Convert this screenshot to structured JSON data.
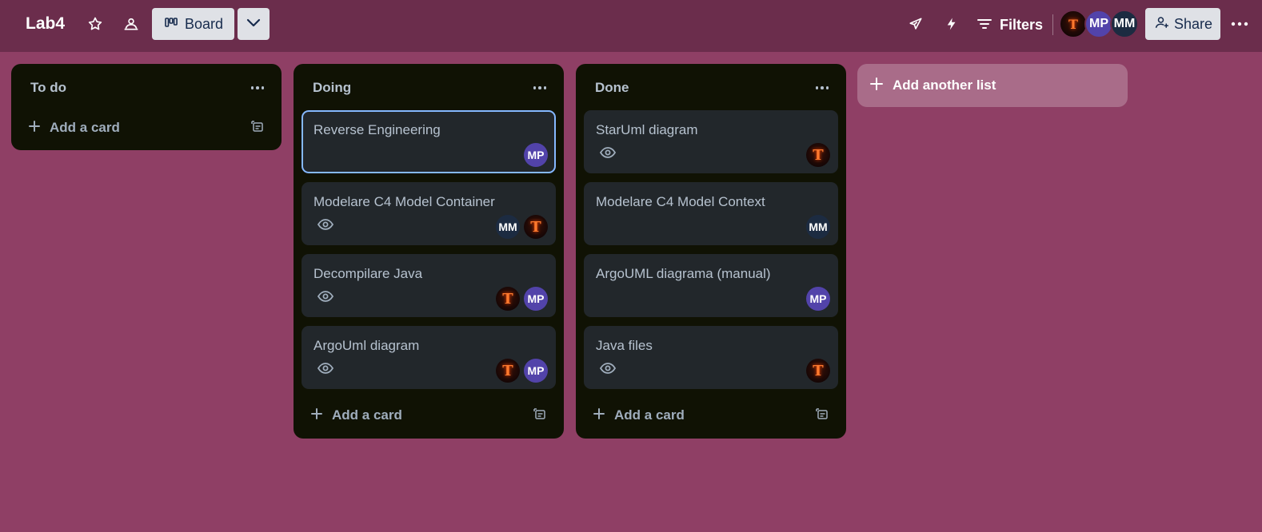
{
  "board": {
    "title": "Lab4",
    "view_label": "Board",
    "filters_label": "Filters",
    "share_label": "Share",
    "members": [
      {
        "initials": "T",
        "kind": "image"
      },
      {
        "initials": "MP"
      },
      {
        "initials": "MM"
      }
    ]
  },
  "colors": {
    "background": "#8f3f65",
    "header": "#6b2d4c",
    "list": "#101204",
    "card": "#22272b",
    "avatar_mp": "#5243aa",
    "avatar_mm": "#1c2b41",
    "card_focus": "#85b8ff"
  },
  "lists": [
    {
      "title": "To do",
      "add_card_label": "Add a card",
      "cards": []
    },
    {
      "title": "Doing",
      "add_card_label": "Add a card",
      "cards": [
        {
          "title": "Reverse Engineering",
          "watching": false,
          "members": [
            "MP"
          ]
        },
        {
          "title": "Modelare C4 Model Container",
          "watching": true,
          "members": [
            "MM",
            "T"
          ]
        },
        {
          "title": "Decompilare Java",
          "watching": true,
          "members": [
            "T",
            "MP"
          ]
        },
        {
          "title": "ArgoUml diagram",
          "watching": true,
          "members": [
            "T",
            "MP"
          ]
        }
      ]
    },
    {
      "title": "Done",
      "add_card_label": "Add a card",
      "cards": [
        {
          "title": "StarUml diagram",
          "watching": true,
          "members": [
            "T"
          ]
        },
        {
          "title": "Modelare C4 Model Context",
          "watching": false,
          "members": [
            "MM"
          ]
        },
        {
          "title": "ArgoUML diagrama (manual)",
          "watching": false,
          "members": [
            "MP"
          ]
        },
        {
          "title": "Java files",
          "watching": true,
          "members": [
            "T"
          ]
        }
      ]
    }
  ],
  "add_list_label": "Add another list"
}
